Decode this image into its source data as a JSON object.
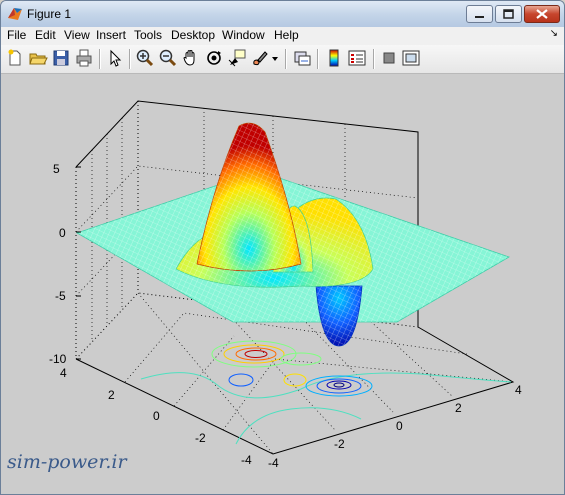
{
  "window": {
    "title": "Figure 1"
  },
  "menubar": {
    "items": [
      "File",
      "Edit",
      "View",
      "Insert",
      "Tools",
      "Desktop",
      "Window",
      "Help"
    ]
  },
  "toolbar": {
    "icons": [
      "new-figure-icon",
      "open-file-icon",
      "save-icon",
      "print-icon",
      "edit-plot-arrow-icon",
      "zoom-in-icon",
      "zoom-out-icon",
      "pan-hand-icon",
      "rotate-3d-icon",
      "data-cursor-icon",
      "brush-icon",
      "brush-dropdown-icon",
      "link-plot-icon",
      "insert-colorbar-icon",
      "insert-legend-icon",
      "hide-plot-tools-icon",
      "show-plot-tools-icon"
    ]
  },
  "axes": {
    "z_ticks": [
      "5",
      "0",
      "-5",
      "-10"
    ],
    "y_ticks": [
      "4",
      "2",
      "0",
      "-2",
      "-4"
    ],
    "x_ticks": [
      "-4",
      "-2",
      "0",
      "2",
      "4"
    ]
  },
  "chart_data": {
    "type": "surface",
    "description_function": "peaks",
    "xlim": [
      -4,
      4
    ],
    "ylim": [
      -4,
      4
    ],
    "zlim": [
      -10,
      5
    ],
    "grid": true,
    "colormap": "jet",
    "contours_projected": true
  },
  "watermark": "sim-power.ir"
}
